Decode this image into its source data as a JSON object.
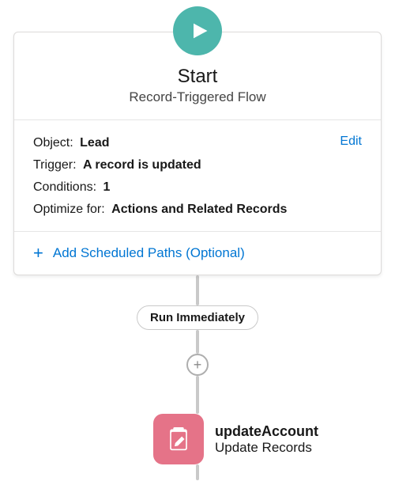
{
  "start": {
    "title": "Start",
    "subtitle": "Record-Triggered Flow",
    "edit_label": "Edit",
    "object_label": "Object:",
    "object_value": "Lead",
    "trigger_label": "Trigger:",
    "trigger_value": "A record is updated",
    "conditions_label": "Conditions:",
    "conditions_value": "1",
    "optimize_label": "Optimize for:",
    "optimize_value": "Actions and Related Records",
    "add_paths_label": "Add Scheduled Paths (Optional)"
  },
  "path": {
    "run_label": "Run Immediately"
  },
  "node": {
    "title": "updateAccount",
    "subtitle": "Update Records"
  }
}
